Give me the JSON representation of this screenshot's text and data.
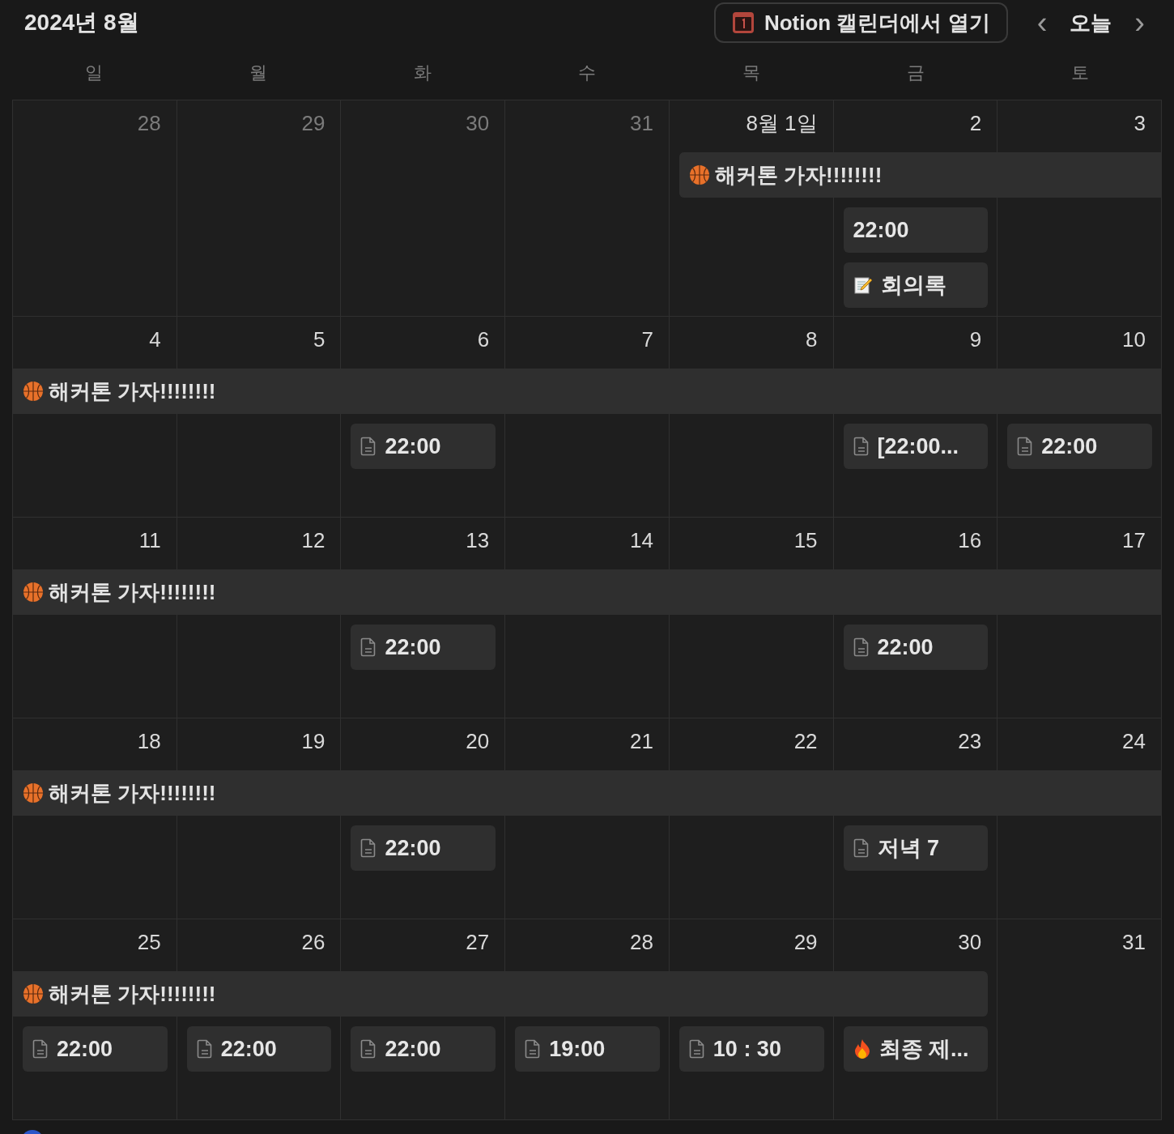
{
  "header": {
    "title": "2024년 8월",
    "open_button": "Notion 캘린더에서 열기",
    "today_button": "오늘",
    "prev_button": "‹",
    "next_button": "›"
  },
  "weekdays": [
    "일",
    "월",
    "화",
    "수",
    "목",
    "금",
    "토"
  ],
  "weeks": [
    {
      "banner": {
        "title": "해커톤 가자!!!!!!!!"
      },
      "days": [
        {
          "label": "28",
          "in_month": false,
          "in_banner": false
        },
        {
          "label": "29",
          "in_month": false,
          "in_banner": false
        },
        {
          "label": "30",
          "in_month": false,
          "in_banner": false
        },
        {
          "label": "31",
          "in_month": false,
          "in_banner": false
        },
        {
          "label": "8월 1일",
          "in_month": true,
          "in_banner": true
        },
        {
          "label": "2",
          "in_month": true,
          "in_banner": true,
          "events": [
            {
              "kind": "plain",
              "title": "22:00"
            },
            {
              "kind": "memo",
              "title": "회의록"
            }
          ]
        },
        {
          "label": "3",
          "in_month": true,
          "in_banner": true
        }
      ]
    },
    {
      "banner": {
        "title": "해커톤 가자!!!!!!!!"
      },
      "days": [
        {
          "label": "4",
          "in_month": true,
          "in_banner": true
        },
        {
          "label": "5",
          "in_month": true,
          "in_banner": true
        },
        {
          "label": "6",
          "in_month": true,
          "in_banner": true,
          "events": [
            {
              "kind": "page",
              "title": "22:00"
            }
          ]
        },
        {
          "label": "7",
          "in_month": true,
          "in_banner": true
        },
        {
          "label": "8",
          "in_month": true,
          "in_banner": true
        },
        {
          "label": "9",
          "in_month": true,
          "in_banner": true,
          "events": [
            {
              "kind": "page",
              "title": "[22:00..."
            }
          ]
        },
        {
          "label": "10",
          "in_month": true,
          "in_banner": true,
          "events": [
            {
              "kind": "page",
              "title": "22:00"
            }
          ]
        }
      ]
    },
    {
      "banner": {
        "title": "해커톤 가자!!!!!!!!"
      },
      "days": [
        {
          "label": "11",
          "in_month": true,
          "in_banner": true
        },
        {
          "label": "12",
          "in_month": true,
          "in_banner": true
        },
        {
          "label": "13",
          "in_month": true,
          "in_banner": true,
          "events": [
            {
              "kind": "page",
              "title": "22:00"
            }
          ]
        },
        {
          "label": "14",
          "in_month": true,
          "in_banner": true
        },
        {
          "label": "15",
          "in_month": true,
          "in_banner": true
        },
        {
          "label": "16",
          "in_month": true,
          "in_banner": true,
          "events": [
            {
              "kind": "page",
              "title": "22:00"
            }
          ]
        },
        {
          "label": "17",
          "in_month": true,
          "in_banner": true
        }
      ]
    },
    {
      "banner": {
        "title": "해커톤 가자!!!!!!!!"
      },
      "days": [
        {
          "label": "18",
          "in_month": true,
          "in_banner": true
        },
        {
          "label": "19",
          "in_month": true,
          "in_banner": true
        },
        {
          "label": "20",
          "in_month": true,
          "in_banner": true,
          "events": [
            {
              "kind": "page",
              "title": "22:00"
            }
          ]
        },
        {
          "label": "21",
          "in_month": true,
          "in_banner": true
        },
        {
          "label": "22",
          "in_month": true,
          "in_banner": true
        },
        {
          "label": "23",
          "in_month": true,
          "in_banner": true,
          "events": [
            {
              "kind": "page",
              "title": "저녁 7"
            }
          ]
        },
        {
          "label": "24",
          "in_month": true,
          "in_banner": true
        }
      ]
    },
    {
      "banner": {
        "title": "해커톤 가자!!!!!!!!"
      },
      "days": [
        {
          "label": "25",
          "in_month": true,
          "in_banner": true,
          "events": [
            {
              "kind": "page",
              "title": "22:00"
            }
          ]
        },
        {
          "label": "26",
          "in_month": true,
          "in_banner": true,
          "events": [
            {
              "kind": "page",
              "title": "22:00"
            }
          ]
        },
        {
          "label": "27",
          "in_month": true,
          "in_banner": true,
          "events": [
            {
              "kind": "page",
              "title": "22:00"
            }
          ]
        },
        {
          "label": "28",
          "in_month": true,
          "in_banner": true,
          "events": [
            {
              "kind": "page",
              "title": "19:00"
            }
          ]
        },
        {
          "label": "29",
          "in_month": true,
          "in_banner": true,
          "events": [
            {
              "kind": "page",
              "title": "10 : 30"
            }
          ]
        },
        {
          "label": "30",
          "in_month": true,
          "in_banner": true,
          "events": [
            {
              "kind": "fire",
              "title": "최종 제..."
            }
          ]
        },
        {
          "label": "31",
          "in_month": true,
          "in_banner": false
        }
      ]
    }
  ]
}
